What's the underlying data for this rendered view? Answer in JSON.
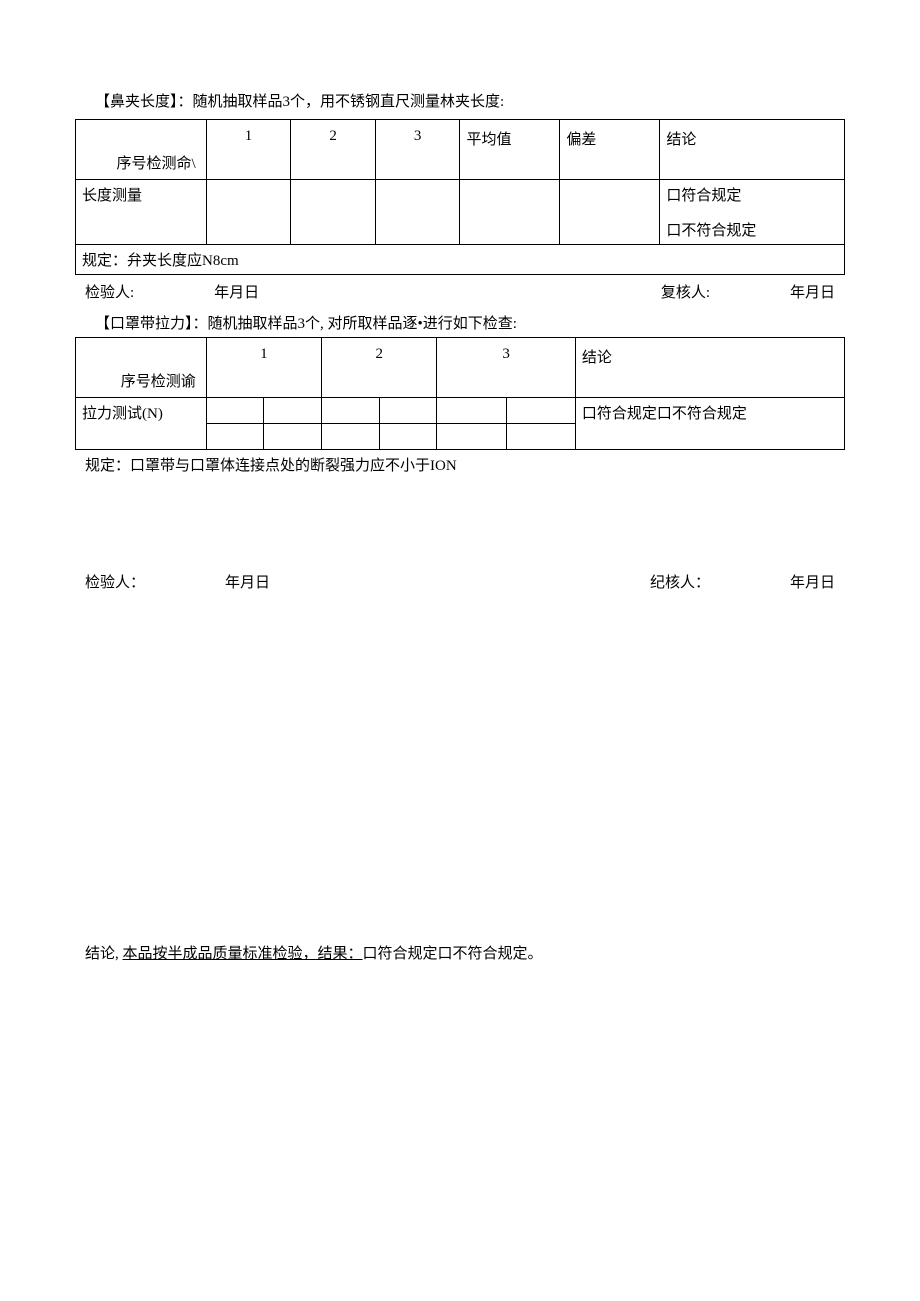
{
  "section1": {
    "title": "【鼻夹长度】：随机抽取样品3个，用不锈钢直尺测量林夹长度:",
    "diag_label": "序号检测命\\",
    "col1": "1",
    "col2": "2",
    "col3": "3",
    "col_avg": "平均值",
    "col_dev": "偏差",
    "col_conc": "结论",
    "row_label": "长度测量",
    "conc_pass": "口符合规定",
    "conc_fail": "口不符合规定",
    "rule": "规定：弁夹长度应N8cm"
  },
  "sig1": {
    "inspector": "检验人:",
    "date1": "年月日",
    "reviewer": "复核人:",
    "date2": "年月日"
  },
  "section2": {
    "title": "【口罩带拉力】：随机抽取样品3个, 对所取样品逐•进行如下检查:",
    "diag_label": "序号检测谕",
    "col1": "1",
    "col2": "2",
    "col3": "3",
    "col_conc": "结论",
    "row_label": "拉力测试(N)",
    "conc_text": "口符合规定口不符合规定",
    "rule": "规定：口罩带与口罩体连接点处的断裂强力应不小于ION"
  },
  "sig2": {
    "inspector": "检验人：",
    "date1": "年月日",
    "reviewer": "纪核人：",
    "date2": "年月日"
  },
  "conclusion": {
    "prefix": "结论, ",
    "underlined": "本品按半成品质量标准检验，结果：",
    "suffix": "口符合规定口不符合规定。"
  }
}
